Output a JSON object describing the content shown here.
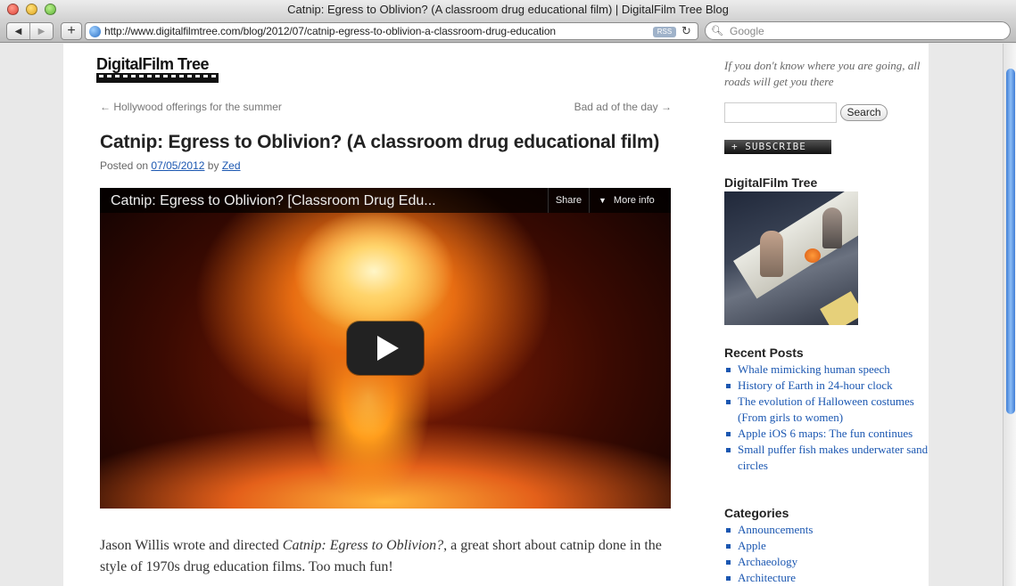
{
  "window": {
    "title": "Catnip: Egress to Oblivion? (A classroom drug educational film) | DigitalFilm Tree Blog"
  },
  "toolbar": {
    "url": "http://www.digitalfilmtree.com/blog/2012/07/catnip-egress-to-oblivion-a-classroom-drug-education",
    "rss_label": "RSS",
    "search_placeholder": "Google"
  },
  "site": {
    "logo_text": "DigitalFilm Tree"
  },
  "nav": {
    "prev": "← Hollywood offerings for the summer",
    "next": "Bad ad of the day →"
  },
  "post": {
    "title": "Catnip: Egress to Oblivion? (A classroom drug educational film)",
    "meta_prefix": "Posted on",
    "date": "07/05/2012",
    "meta_by": "by",
    "author": "Zed",
    "body_1": "Jason Willis wrote and directed ",
    "body_italic": "Catnip: Egress to Oblivion?",
    "body_2": ", a great short about catnip done in the style of 1970s drug education films. Too much fun!"
  },
  "video": {
    "title": "Catnip: Egress to Oblivion? [Classroom Drug Edu...",
    "share_label": "Share",
    "more_info_label": "More info"
  },
  "sidebar": {
    "motto": "If you don't know where you are going, all roads will get you there",
    "search_button": "Search",
    "subscribe_label": "+ SUBSCRIBE",
    "photo_widget_title": "DigitalFilm Tree",
    "recent_posts_title": "Recent Posts",
    "recent_posts": [
      "Whale mimicking human speech",
      "History of Earth in 24-hour clock",
      "The evolution of Halloween costumes (From girls to women)",
      "Apple iOS 6 maps: The fun continues",
      "Small puffer fish makes underwater sand circles"
    ],
    "categories_title": "Categories",
    "categories": [
      "Announcements",
      "Apple",
      "Archaeology",
      "Architecture"
    ]
  }
}
